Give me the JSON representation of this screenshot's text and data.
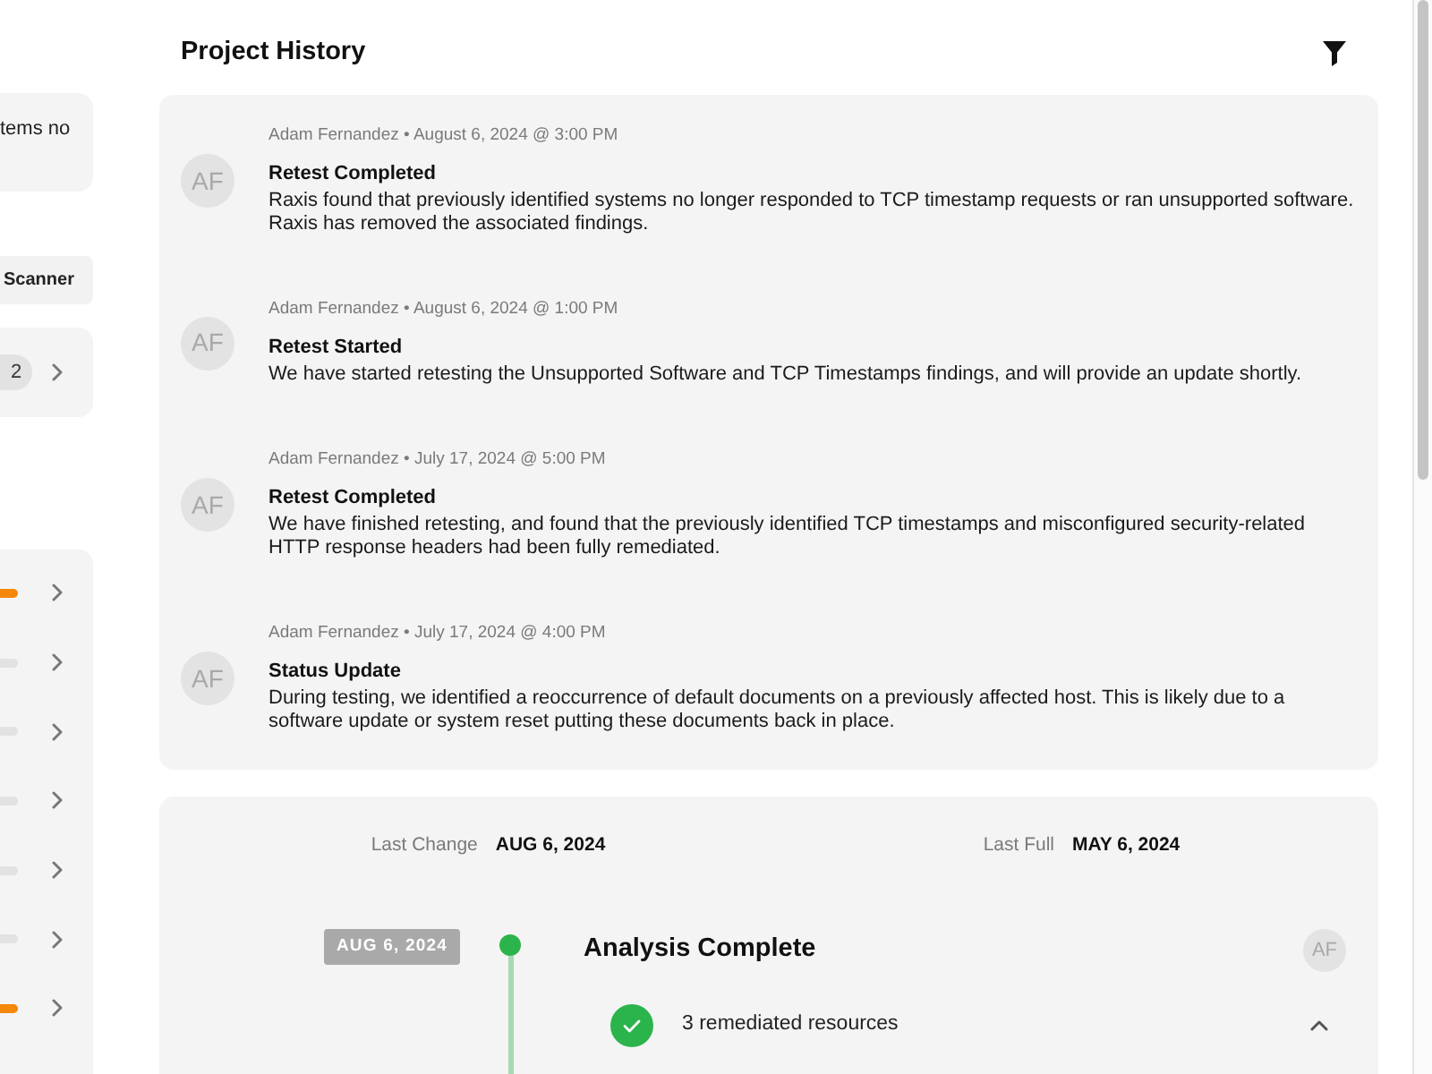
{
  "sidebar": {
    "note": "tems no",
    "chip": {
      "label": "Scanner"
    },
    "pager": {
      "pages": [
        {
          "label": "2",
          "selected": true
        }
      ]
    },
    "rows": [
      {
        "color": "#f5870a"
      },
      {
        "color": "#e2e2e2"
      },
      {
        "color": "#e2e2e2"
      },
      {
        "color": "#e2e2e2"
      },
      {
        "color": "#e2e2e2"
      },
      {
        "color": "#e2e2e2"
      },
      {
        "color": "#f5870a"
      }
    ]
  },
  "page": {
    "title": "Project History"
  },
  "history": [
    {
      "initials": "AF",
      "meta": "Adam Fernandez • August 6, 2024 @ 3:00 PM",
      "title": "Retest Completed",
      "body": "Raxis found that previously identified systems no longer responded to TCP timestamp requests or ran unsupported software. Raxis has removed the associated findings."
    },
    {
      "initials": "AF",
      "meta": "Adam Fernandez • August 6, 2024 @ 1:00 PM",
      "title": "Retest Started",
      "body": "We have started retesting the Unsupported Software and TCP Timestamps findings, and will provide an update shortly."
    },
    {
      "initials": "AF",
      "meta": "Adam Fernandez • July 17, 2024 @ 5:00 PM",
      "title": "Retest Completed",
      "body": "We have finished retesting, and found that the previously identified TCP timestamps and misconfigured security-related HTTP response headers had been fully remediated."
    },
    {
      "initials": "AF",
      "meta": "Adam Fernandez • July 17, 2024 @ 4:00 PM",
      "title": "Status Update",
      "body": "During testing, we identified a reoccurrence of default documents on a previously affected host. This is likely due to a software update or system reset putting these documents back in place."
    }
  ],
  "summary": [
    {
      "label": "Last Change",
      "value": "AUG 6, 2024"
    },
    {
      "label": "Last Full",
      "value": "MAY 6, 2024"
    }
  ],
  "timeline": [
    {
      "date": "AUG 6, 2024",
      "title": "Analysis Complete",
      "initials": "AF",
      "groups": [
        {
          "kind": "remediated",
          "label": "3 remediated resources",
          "expanded": true
        }
      ]
    }
  ]
}
